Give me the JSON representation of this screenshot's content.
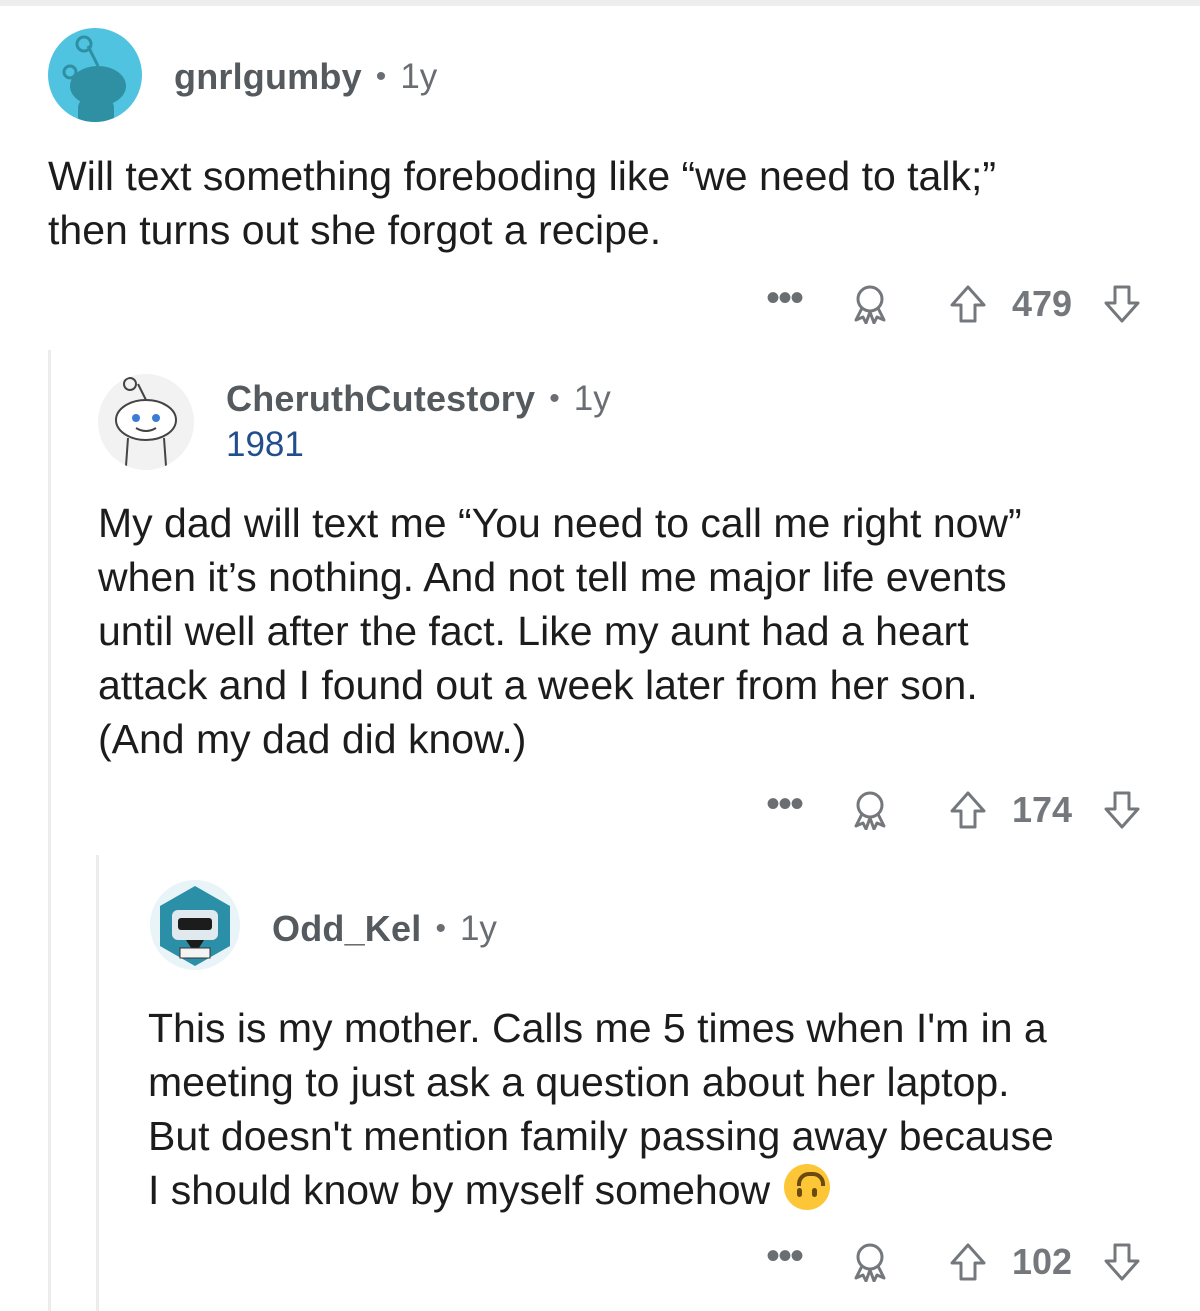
{
  "comments": [
    {
      "username": "gnrlgumby",
      "age": "1y",
      "body": [
        "Will text something foreboding like “we need to talk;”",
        "then turns out she forgot a recipe."
      ],
      "score": "479",
      "avatar_color": "#4fc3e0"
    },
    {
      "username": "CheruthCutestory",
      "age": "1y",
      "flair": "1981",
      "body": [
        "My dad will text me “You need to call me right now”",
        "when it’s nothing. And not tell me major life events",
        "until well after the fact. Like my aunt had a heart",
        "attack and I found out a week later from her son.",
        "(And my dad did know.)"
      ],
      "score": "174",
      "avatar_color": "#f2f2f2"
    },
    {
      "username": "Odd_Kel",
      "age": "1y",
      "body": [
        "This is my mother. Calls me 5 times when I'm in a",
        "meeting to just ask a question about her laptop.",
        "But doesn't mention family passing away because",
        "I should know by myself somehow"
      ],
      "score": "102",
      "emoji": "upside-down-face-emoji",
      "avatar_color": "#2b8fa8"
    }
  ],
  "separator": "•",
  "more_label": "•••",
  "icons": {
    "award": "award-icon",
    "upvote": "upvote-arrow-icon",
    "downvote": "downvote-arrow-icon",
    "more": "more-options-icon"
  }
}
